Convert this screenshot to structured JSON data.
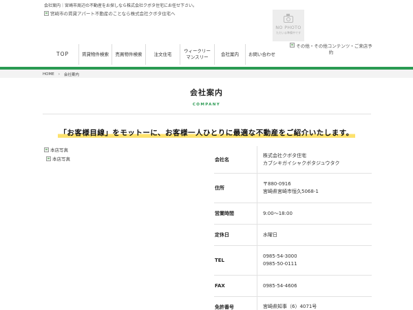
{
  "header": {
    "tagline": "会社案内｜宮崎市周辺の不動産をお探しなら株式会社クボタ住宅にお任せ下さい。",
    "logo_alt": "宮崎市の賃貸アパート不動産のことなら株式会社クボタ住宅へ",
    "no_photo": {
      "title": "NO PHOTO",
      "subtitle": "ただいま準備中です"
    }
  },
  "nav": {
    "items": [
      {
        "label": "TOP"
      },
      {
        "label": "賃貸物件検索"
      },
      {
        "label": "売買物件検索"
      },
      {
        "label": "注文住宅"
      },
      {
        "label": "ウィークリー\nマンスリー"
      },
      {
        "label": "会社案内"
      },
      {
        "label": "お問い合わせ"
      }
    ],
    "other": "その他・その他コンテンツ・ご来店予約"
  },
  "breadcrumb": {
    "home": "HOME",
    "current": "会社案内"
  },
  "page": {
    "title": "会社案内",
    "subtitle": "COMPANY"
  },
  "motto": "「お客様目線」をモットーに、お客様一人ひとりに最適な不動産をご紹介いたします。",
  "photos": {
    "alt1": "本店写真",
    "alt2": "本店写真"
  },
  "company_info": [
    {
      "label": "会社名",
      "lines": [
        "株式会社クボタ住宅",
        "カブシキガイシャクボタジュウタク"
      ]
    },
    {
      "label": "住所",
      "lines": [
        "〒880-0916",
        "宮崎県宮崎市恒久5068-1"
      ]
    },
    {
      "label": "営業時間",
      "lines": [
        "9:00〜18:00"
      ]
    },
    {
      "label": "定休日",
      "lines": [
        "水曜日"
      ]
    },
    {
      "label": "TEL",
      "lines": [
        "0985-54-3000",
        "0985-50-0111"
      ]
    },
    {
      "label": "FAX",
      "lines": [
        "0985-54-4606"
      ]
    },
    {
      "label": "免許番号",
      "lines": [
        "宮崎県知事（6）4071号"
      ]
    }
  ],
  "colors": {
    "brand_green": "#2a9a52",
    "highlight_yellow": "#fde26d"
  }
}
